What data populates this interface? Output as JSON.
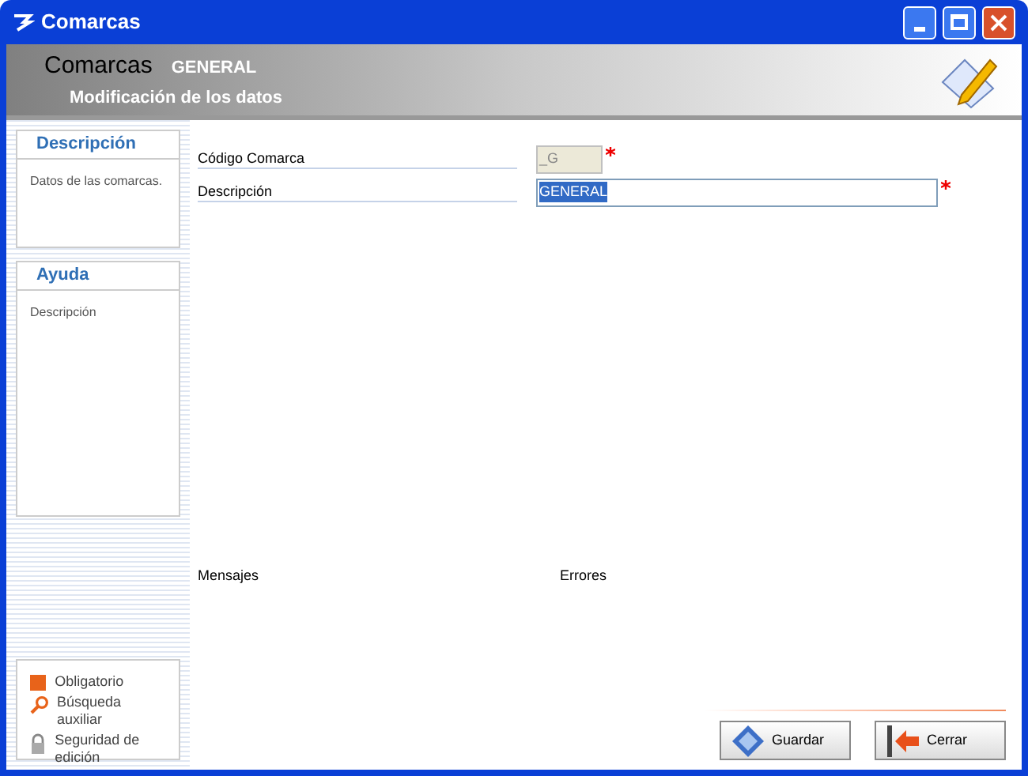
{
  "window": {
    "title": "Comarcas"
  },
  "header": {
    "title": "Comarcas",
    "record": "GENERAL",
    "subtitle": "Modificación de los datos"
  },
  "side_panels": [
    {
      "title": "Descripción",
      "text": "Datos de las comarcas."
    },
    {
      "title": "Ayuda",
      "text": "Descripción"
    }
  ],
  "fields": [
    {
      "label": "Código Comarca",
      "value": "_G",
      "required": true,
      "disabled": true,
      "selected": false,
      "kind": "code"
    },
    {
      "label": "Descripción",
      "value": "GENERAL",
      "required": true,
      "disabled": false,
      "selected": true,
      "kind": "text"
    }
  ],
  "messages": {
    "left": "Mensajes",
    "right": "Errores"
  },
  "legend": [
    {
      "kind": "required",
      "label": "Obligatorio"
    },
    {
      "kind": "search",
      "label": "Búsqueda auxiliar"
    },
    {
      "kind": "lock",
      "label": "Seguridad de edición"
    }
  ],
  "buttons": [
    {
      "kind": "save",
      "label": "Guardar"
    },
    {
      "kind": "close",
      "label": "Cerrar"
    }
  ]
}
